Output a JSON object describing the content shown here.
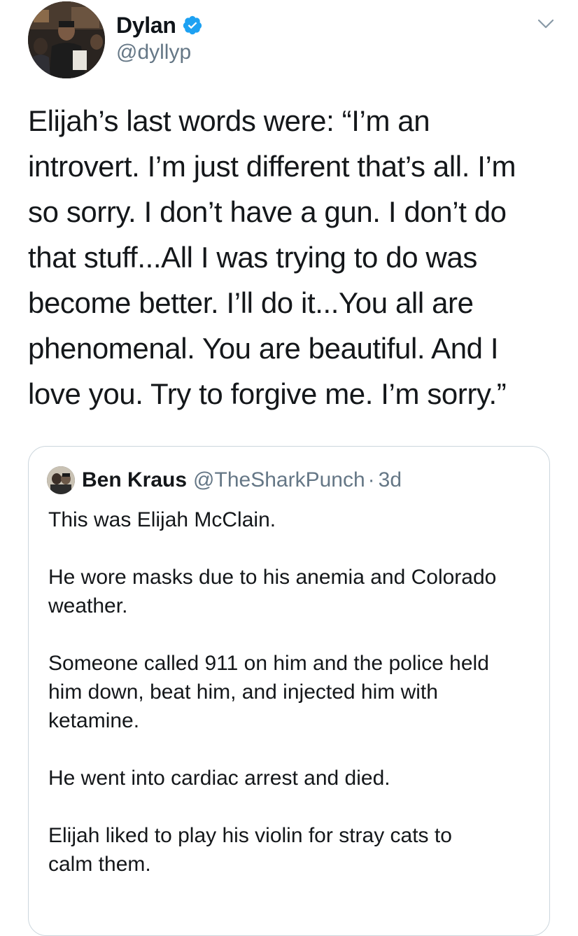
{
  "tweet": {
    "author": {
      "display_name": "Dylan",
      "handle": "@dyllyp",
      "verified": true,
      "avatar_icon": "profile-photo"
    },
    "menu_icon": "chevron-down-icon",
    "text_lines": [
      "Elijah’s last words were: “I’m an",
      "introvert. I’m just different that’s all. I’m",
      "so sorry. I don’t have a gun. I don’t do",
      "that stuff...All I was trying to do was",
      "become better. I’ll do it...You all are",
      "phenomenal. You are beautiful. And I",
      "love you. Try to forgive me. I’m sorry.”"
    ]
  },
  "quoted_tweet": {
    "author": {
      "display_name": "Ben Kraus",
      "handle": "@TheSharkPunch",
      "separator": "·",
      "time": "3d"
    },
    "paragraphs": [
      [
        "This was Elijah McClain."
      ],
      [
        "He wore masks due to his anemia and Colorado",
        "weather."
      ],
      [
        "Someone called 911 on him and the police held",
        "him down, beat him, and injected him with",
        "ketamine."
      ],
      [
        "He went into cardiac arrest and died."
      ],
      [
        "Elijah liked to play his violin for stray cats to",
        "calm them."
      ]
    ]
  },
  "colors": {
    "text": "#14171a",
    "secondary": "#657786",
    "verified_blue": "#1da1f2",
    "border": "#ccd6dd"
  }
}
